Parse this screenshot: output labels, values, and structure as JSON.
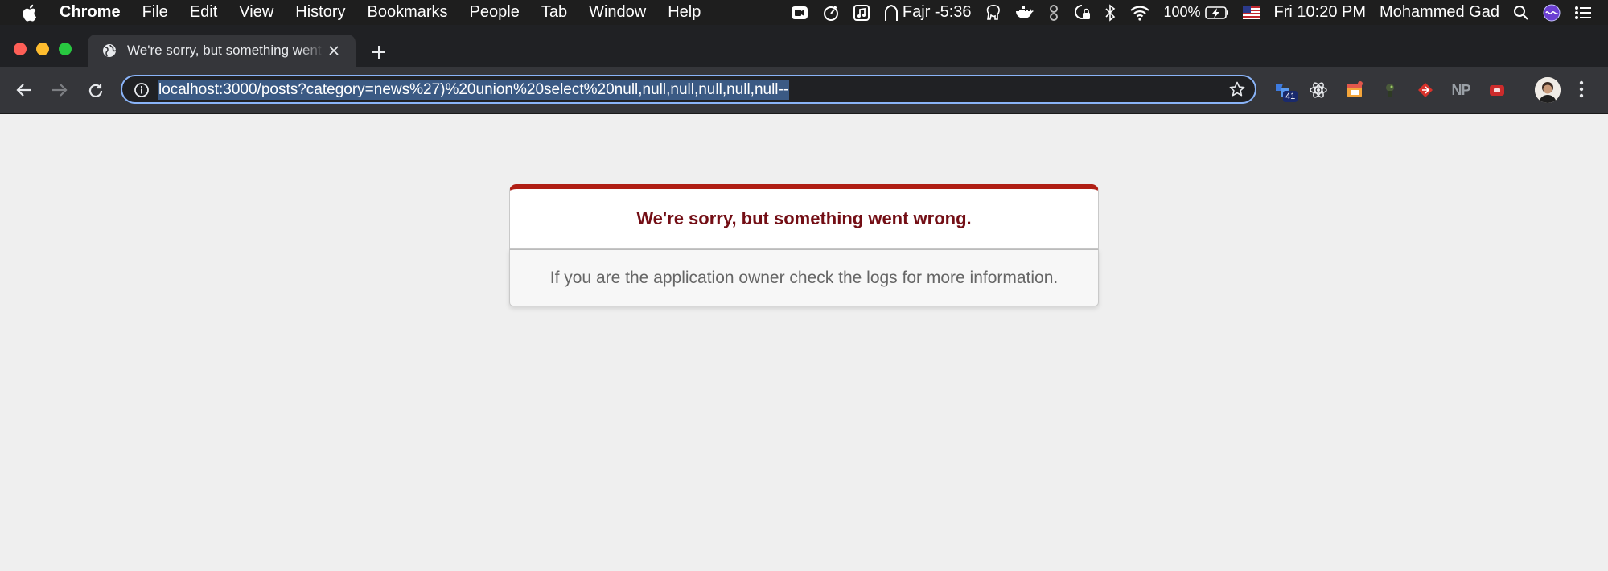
{
  "menubar": {
    "apple_icon": "apple-logo",
    "app_name": "Chrome",
    "items": [
      "File",
      "Edit",
      "View",
      "History",
      "Bookmarks",
      "People",
      "Tab",
      "Window",
      "Help"
    ],
    "status": {
      "prayer": "Fajr -5:36",
      "battery": "100%",
      "datetime": "Fri 10:20 PM",
      "user": "Mohammed Gad"
    }
  },
  "tab": {
    "title": "We're sorry, but something went wrong",
    "favicon": "globe-icon"
  },
  "toolbar": {
    "url": "localhost:3000/posts?category=news%27)%20union%20select%20null,null,null,null,null,null--",
    "extension_badge": "41",
    "np_label": "NP"
  },
  "error": {
    "title": "We're sorry, but something went wrong.",
    "message": "If you are the application owner check the logs for more information."
  },
  "colors": {
    "error_title": "#730e15",
    "error_border_top": "#b01e14",
    "page_background": "#efefef",
    "url_highlight": "#3b5a84"
  }
}
